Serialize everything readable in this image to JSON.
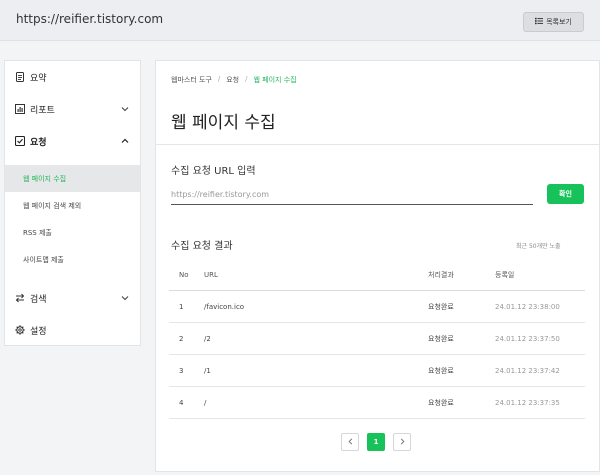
{
  "header": {
    "site_url": "https://reifier.tistory.com",
    "list_button_label": "목록보기"
  },
  "sidebar": {
    "items": [
      {
        "label": "요약",
        "icon": "document-icon"
      },
      {
        "label": "리포트",
        "icon": "chart-icon"
      },
      {
        "label": "요청",
        "icon": "checkbox-icon"
      },
      {
        "label": "검색",
        "icon": "swap-icon"
      },
      {
        "label": "설정",
        "icon": "gear-icon"
      }
    ],
    "sub_items": [
      {
        "label": "웹 페이지 수집",
        "active": true
      },
      {
        "label": "웹 페이지 검색 제외",
        "active": false
      },
      {
        "label": "RSS 제출",
        "active": false
      },
      {
        "label": "사이트맵 제출",
        "active": false
      }
    ]
  },
  "main": {
    "breadcrumb": [
      "웹마스터 도구",
      "요청",
      "웹 페이지 수집"
    ],
    "breadcrumb_sep": "/",
    "title": "웹 페이지 수집",
    "input_section_title": "수집 요청 URL 입력",
    "url_placeholder": "https://reifier.tistory.com",
    "confirm_label": "확인",
    "results_title": "수집 요청 결과",
    "results_note": "최근 50개만 노출",
    "columns": [
      "No",
      "URL",
      "처리결과",
      "등록일"
    ],
    "rows": [
      {
        "no": "1",
        "url": "/favicon.ico",
        "status": "요청완료",
        "date": "24.01.12 23:38:00"
      },
      {
        "no": "2",
        "url": "/2",
        "status": "요청완료",
        "date": "24.01.12 23:37:50"
      },
      {
        "no": "3",
        "url": "/1",
        "status": "요청완료",
        "date": "24.01.12 23:37:42"
      },
      {
        "no": "4",
        "url": "/",
        "status": "요청완료",
        "date": "24.01.12 23:37:35"
      }
    ],
    "pagination": {
      "current": "1"
    }
  },
  "colors": {
    "accent": "#18c25a"
  }
}
